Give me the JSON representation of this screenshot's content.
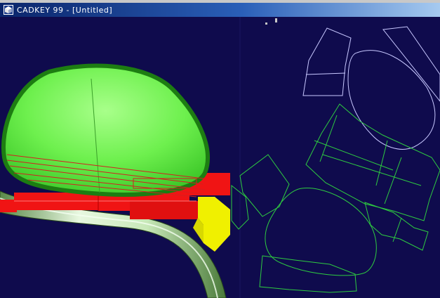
{
  "window": {
    "title": "CADKEY 99 - [Untitled]"
  },
  "icons": {
    "app": "cadkey-app-icon"
  },
  "colors": {
    "background": "#0f0b4d",
    "solid_green": "#55e63c",
    "solid_red": "#f01414",
    "solid_yellow": "#f0f000",
    "wireframe_green": "#2ecc40",
    "wireframe_white": "#c8c8ff"
  }
}
